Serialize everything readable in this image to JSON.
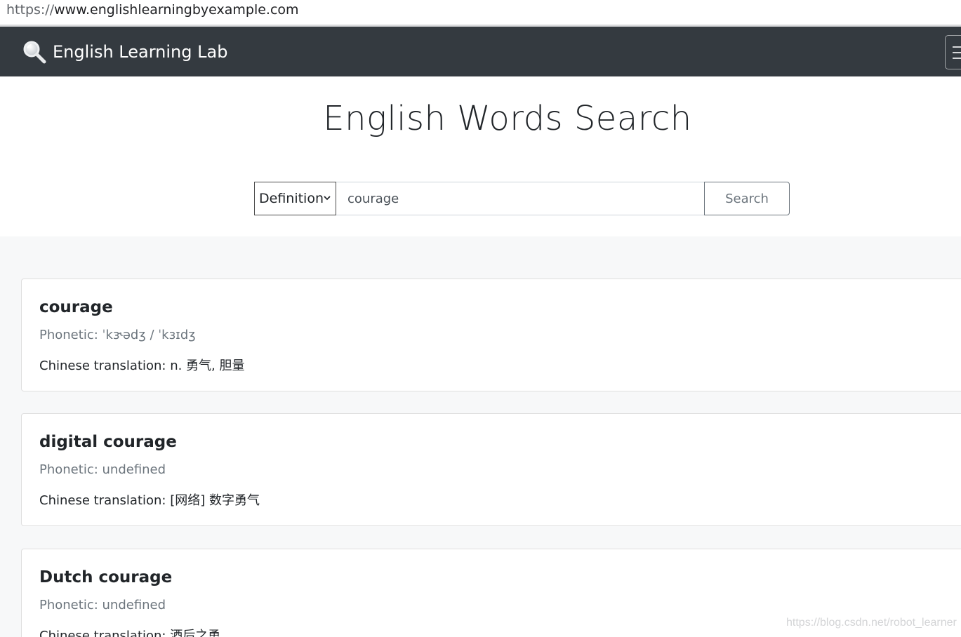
{
  "browser": {
    "url_scheme": "https://",
    "url_host": "www.englishlearningbyexample.com"
  },
  "navbar": {
    "brand_icon": "magnifier-icon",
    "brand_text": "English Learning Lab",
    "toggler_icon": "hamburger-icon"
  },
  "hero": {
    "title": "English Words Search"
  },
  "search": {
    "mode_selected": "Definition",
    "query": "courage",
    "button_label": "Search"
  },
  "results": [
    {
      "word": "courage",
      "phonetic": "Phonetic: ˈkɝədʒ / ˈkɜɪdʒ",
      "translation": "Chinese translation: n. 勇气, 胆量"
    },
    {
      "word": "digital courage",
      "phonetic": "Phonetic: undefined",
      "translation": "Chinese translation: [网络] 数字勇气"
    },
    {
      "word": "Dutch courage",
      "phonetic": "Phonetic: undefined",
      "translation": "Chinese translation: 酒后之勇"
    }
  ],
  "watermark": "https://blog.csdn.net/robot_learner",
  "colors": {
    "navbar_bg": "#343a40",
    "results_bg": "#f7f8f9",
    "muted_text": "#6c757d"
  }
}
